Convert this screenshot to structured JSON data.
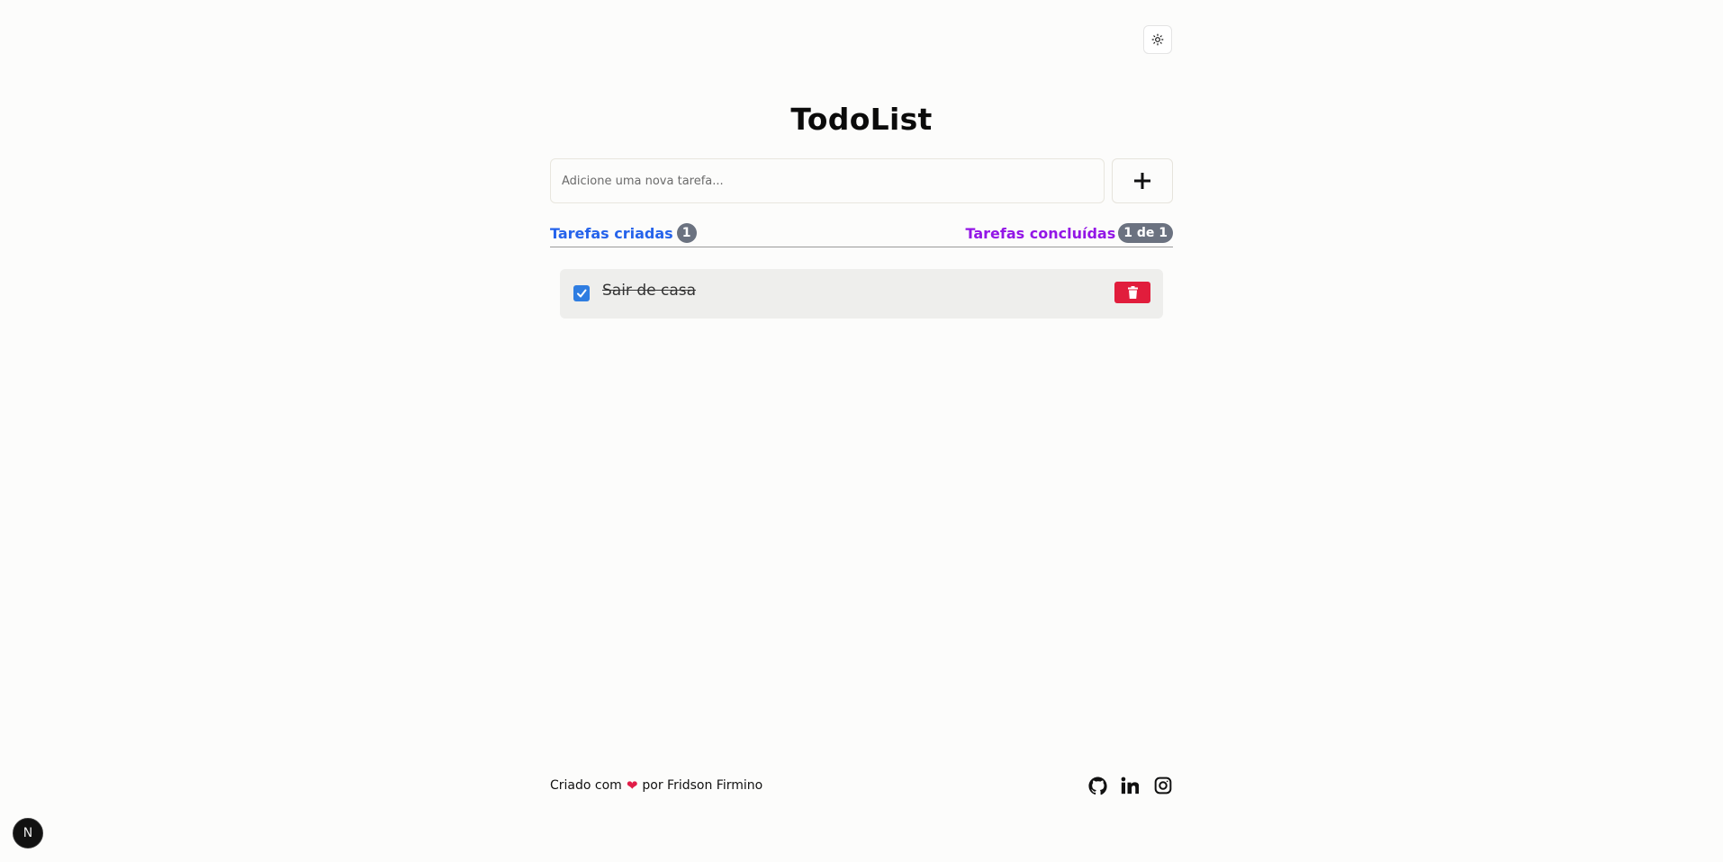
{
  "header": {
    "title": "TodoList",
    "theme_toggle_icon": "sun-icon"
  },
  "new_task": {
    "placeholder": "Adicione uma nova tarefa...",
    "value": "",
    "add_icon": "plus-icon"
  },
  "stats": {
    "created_label": "Tarefas criadas",
    "created_count": "1",
    "completed_label": "Tarefas concluídas",
    "completed_count": "1 de 1",
    "created_color": "#2563eb",
    "completed_color": "#9316e6"
  },
  "tasks": [
    {
      "text": "Sair de casa",
      "completed": true,
      "delete_icon": "trash-icon"
    }
  ],
  "footer": {
    "credit_prefix": "Criado com",
    "credit_suffix": "por Fridson Firmino",
    "heart_icon": "heart-icon",
    "social_icons": [
      "github-icon",
      "linkedin-icon",
      "instagram-icon"
    ]
  },
  "dev_badge": {
    "label": "N"
  }
}
